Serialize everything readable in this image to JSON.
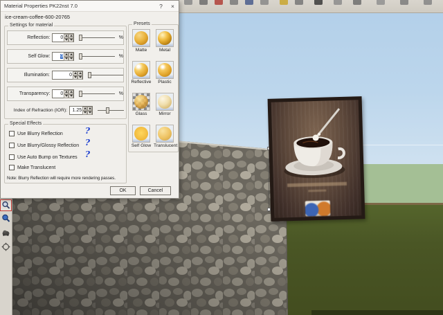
{
  "window": {
    "title": "Material Properties PK22nst 7.0",
    "help": "?",
    "close": "×"
  },
  "dialog": {
    "material_name": "ice-cream-coffee-600-20765",
    "settings_group_label": "Settings for material",
    "sliders": [
      {
        "label": "Reflection:",
        "value": "0",
        "unit": "%"
      },
      {
        "label": "Self Glow:",
        "value": "0",
        "unit": "%"
      },
      {
        "label": "Illumination:",
        "value": "0",
        "unit": ""
      },
      {
        "label": "Transparency:",
        "value": "0",
        "unit": "%"
      }
    ],
    "ior": {
      "label": "Index of Refraction (IOR):",
      "value": "1.25"
    },
    "effects_group_label": "Special Effects",
    "checkboxes": [
      {
        "label": "Use Blurry Reflection",
        "help": "?"
      },
      {
        "label": "Use Blurry/Glossy Reflection",
        "help": "?"
      },
      {
        "label": "Use Auto Bump on Textures",
        "help": "?"
      },
      {
        "label": "Make Translucent",
        "help": ""
      }
    ],
    "note": "Note: Blurry Reflection will require more rendering passes.",
    "buttons": {
      "ok": "OK",
      "cancel": "Cancel"
    },
    "presets_group_label": "Presets",
    "presets": [
      {
        "label": "Matte"
      },
      {
        "label": "Metal"
      },
      {
        "label": "Reflective"
      },
      {
        "label": "Plastic"
      },
      {
        "label": "Glass"
      },
      {
        "label": "Mirror"
      },
      {
        "label": "Self Glow"
      },
      {
        "label": "Translucent"
      }
    ]
  },
  "left_toolbar": {
    "icons": [
      "zoom-window",
      "zoom",
      "pan",
      "orbit"
    ]
  },
  "scene": {
    "colors": {
      "sky": "#b6d2ea",
      "distant_ground": "#a4bf95",
      "grass": "#4a5424",
      "wall_stone": "#8f8b80",
      "poster_brown": "#5a443a",
      "poster_frame": "#241a15",
      "selection_blue": "#316ac5",
      "help_blue": "#1d3fd0",
      "preset_gold": "#eeb83c"
    }
  }
}
